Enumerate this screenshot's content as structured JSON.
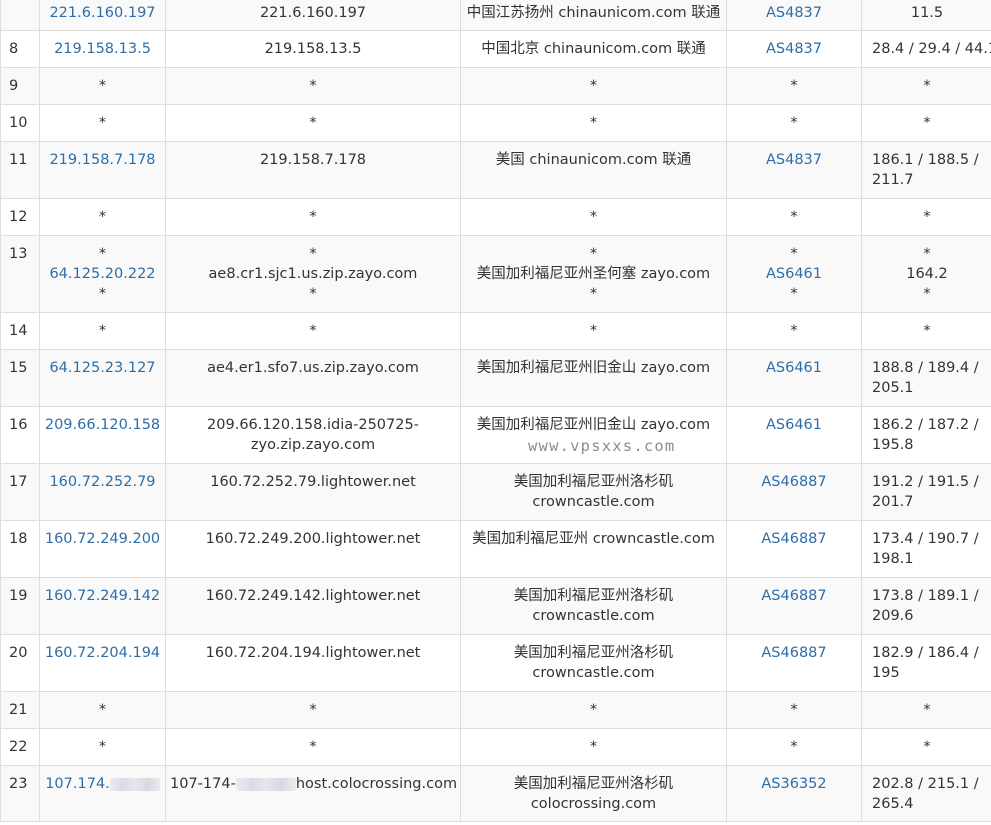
{
  "rows": [
    {
      "hop": "",
      "ip": "221.6.160.197",
      "host": [
        "221.6.160.197"
      ],
      "loc": [
        "中国江苏扬州 chinaunicom.com 联通"
      ],
      "asn": "AS4837",
      "time": [
        "11.5"
      ]
    },
    {
      "hop": "8",
      "ip": "219.158.13.5",
      "host": [
        "219.158.13.5"
      ],
      "loc": [
        "中国北京 chinaunicom.com 联通"
      ],
      "asn": "AS4837",
      "time": [
        "28.4 / 29.4 / 44.1"
      ]
    },
    {
      "hop": "9",
      "ip": "*",
      "host": [
        "*"
      ],
      "loc": [
        "*"
      ],
      "asn": "*",
      "time": [
        "*"
      ]
    },
    {
      "hop": "10",
      "ip": "*",
      "host": [
        "*"
      ],
      "loc": [
        "*"
      ],
      "asn": "*",
      "time": [
        "*"
      ]
    },
    {
      "hop": "11",
      "ip": "219.158.7.178",
      "host": [
        "219.158.7.178"
      ],
      "loc": [
        "美国 chinaunicom.com 联通"
      ],
      "asn": "AS4837",
      "time": [
        "186.1 / 188.5 /",
        "211.7"
      ]
    },
    {
      "hop": "12",
      "ip": "*",
      "host": [
        "*"
      ],
      "loc": [
        "*"
      ],
      "asn": "*",
      "time": [
        "*"
      ]
    },
    {
      "hop": "13",
      "ip_lines": [
        "*",
        "64.125.20.222",
        "*"
      ],
      "host": [
        "*",
        "ae8.cr1.sjc1.us.zip.zayo.com",
        "*"
      ],
      "loc": [
        "*",
        "美国加利福尼亚州圣何塞 zayo.com",
        "*"
      ],
      "asn_lines": [
        "*",
        "AS6461",
        "*"
      ],
      "time": [
        "*",
        "164.2",
        "*"
      ]
    },
    {
      "hop": "14",
      "ip": "*",
      "host": [
        "*"
      ],
      "loc": [
        "*"
      ],
      "asn": "*",
      "time": [
        "*"
      ]
    },
    {
      "hop": "15",
      "ip": "64.125.23.127",
      "host": [
        "ae4.er1.sfo7.us.zip.zayo.com"
      ],
      "loc": [
        "美国加利福尼亚州旧金山 zayo.com"
      ],
      "asn": "AS6461",
      "time": [
        "188.8 / 189.4 /",
        "205.1"
      ]
    },
    {
      "hop": "16",
      "ip": "209.66.120.158",
      "host": [
        "209.66.120.158.idia-250725-",
        "zyo.zip.zayo.com"
      ],
      "loc": [
        "美国加利福尼亚州旧金山 zayo.com"
      ],
      "asn": "AS6461",
      "time": [
        "186.2 / 187.2 /",
        "195.8"
      ]
    },
    {
      "hop": "17",
      "ip": "160.72.252.79",
      "host": [
        "160.72.252.79.lightower.net"
      ],
      "loc": [
        "美国加利福尼亚州洛杉矶",
        "crowncastle.com"
      ],
      "asn": "AS46887",
      "time": [
        "191.2 / 191.5 /",
        "201.7"
      ]
    },
    {
      "hop": "18",
      "ip": "160.72.249.200",
      "host": [
        "160.72.249.200.lightower.net"
      ],
      "loc": [
        "美国加利福尼亚州 crowncastle.com"
      ],
      "asn": "AS46887",
      "time": [
        "173.4 / 190.7 /",
        "198.1"
      ]
    },
    {
      "hop": "19",
      "ip": "160.72.249.142",
      "host": [
        "160.72.249.142.lightower.net"
      ],
      "loc": [
        "美国加利福尼亚州洛杉矶",
        "crowncastle.com"
      ],
      "asn": "AS46887",
      "time": [
        "173.8 / 189.1 /",
        "209.6"
      ]
    },
    {
      "hop": "20",
      "ip": "160.72.204.194",
      "host": [
        "160.72.204.194.lightower.net"
      ],
      "loc": [
        "美国加利福尼亚州洛杉矶",
        "crowncastle.com"
      ],
      "asn": "AS46887",
      "time": [
        "182.9 / 186.4 /",
        "195"
      ]
    },
    {
      "hop": "21",
      "ip": "*",
      "host": [
        "*"
      ],
      "loc": [
        "*"
      ],
      "asn": "*",
      "time": [
        "*"
      ]
    },
    {
      "hop": "22",
      "ip": "*",
      "host": [
        "*"
      ],
      "loc": [
        "*"
      ],
      "asn": "*",
      "time": [
        "*"
      ]
    },
    {
      "hop": "23",
      "ip": "107.174.",
      "ip_blur": true,
      "host_a": "107-174-",
      "host_b": "host.colocrossing.com",
      "host_blur": true,
      "loc": [
        "美国加利福尼亚州洛杉矶",
        "colocrossing.com"
      ],
      "asn": "AS36352",
      "time": [
        "202.8 / 215.1 /",
        "265.4"
      ]
    }
  ],
  "watermark": "www.vpsxxs.com",
  "colors": {
    "link": "#2d6ea8",
    "border": "#dddddd",
    "stripe": "#f9f9f9",
    "text": "#333333"
  }
}
